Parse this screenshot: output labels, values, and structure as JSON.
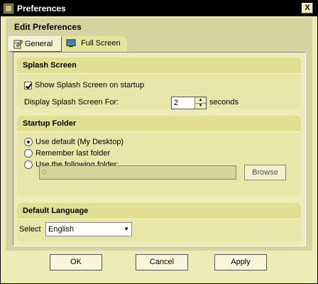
{
  "window": {
    "title": "Preferences",
    "close_glyph": "X",
    "app_icon": "app-icon"
  },
  "panel": {
    "heading": "Edit Preferences"
  },
  "tabs": [
    {
      "label": "General",
      "icon": "settings-icon",
      "selected": true
    },
    {
      "label": "Full Screen",
      "icon": "monitor-icon",
      "selected": false
    }
  ],
  "splash": {
    "title": "Splash Screen",
    "show_label": "Show Splash Screen on startup",
    "show_checked": true,
    "display_label": "Display Splash Screen For:",
    "display_value": "2",
    "unit": "seconds"
  },
  "startup": {
    "title": "Startup Folder",
    "options": [
      {
        "label": "Use default (My Desktop)",
        "selected": true
      },
      {
        "label": "Remember last folder",
        "selected": false
      },
      {
        "label": "Use the following folder:",
        "selected": false
      }
    ],
    "folder_value": "0",
    "browse_label": "Browse"
  },
  "language": {
    "title": "Default Language",
    "select_label": "Select",
    "selected_value": "English"
  },
  "buttons": {
    "ok": "OK",
    "cancel": "Cancel",
    "apply": "Apply"
  },
  "colors": {
    "background": "#eeecb6",
    "titlebar": "#000000",
    "group_header": "#e2df92"
  }
}
